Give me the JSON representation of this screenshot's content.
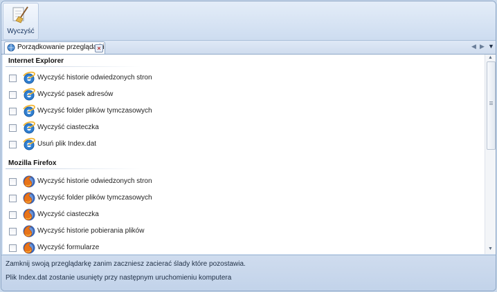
{
  "ribbon": {
    "clean_label": "Wyczyść"
  },
  "tab": {
    "label": "Porządkowanie przeglądarki"
  },
  "groups": [
    {
      "title": "Internet Explorer",
      "items": [
        {
          "label": "Wyczyść historie odwiedzonych stron",
          "checked": false,
          "icon": "ie-icon"
        },
        {
          "label": "Wyczyść pasek adresów",
          "checked": false,
          "icon": "ie-icon"
        },
        {
          "label": "Wyczyść folder plików tymczasowych",
          "checked": false,
          "icon": "ie-icon"
        },
        {
          "label": "Wyczyść ciasteczka",
          "checked": false,
          "icon": "ie-icon"
        },
        {
          "label": "Usuń plik Index.dat",
          "checked": false,
          "icon": "ie-icon"
        }
      ]
    },
    {
      "title": "Mozilla Firefox",
      "items": [
        {
          "label": "Wyczyść historie odwiedzonych stron",
          "checked": false,
          "icon": "firefox-icon"
        },
        {
          "label": "Wyczyść folder plików tymczasowych",
          "checked": false,
          "icon": "firefox-icon"
        },
        {
          "label": "Wyczyść ciasteczka",
          "checked": false,
          "icon": "firefox-icon"
        },
        {
          "label": "Wyczyść historie pobierania plików",
          "checked": false,
          "icon": "firefox-icon"
        },
        {
          "label": "Wyczyść formularze",
          "checked": false,
          "icon": "firefox-icon"
        }
      ]
    }
  ],
  "status": {
    "line1": "Zamknij swoją przeglądarkę zanim zaczniesz zacierać ślady które pozostawia.",
    "line2": "Plik Index.dat zostanie usunięty przy następnym uruchomieniu komputera"
  },
  "colors": {
    "accent": "#c9d9ec",
    "border": "#8ea7c6"
  }
}
